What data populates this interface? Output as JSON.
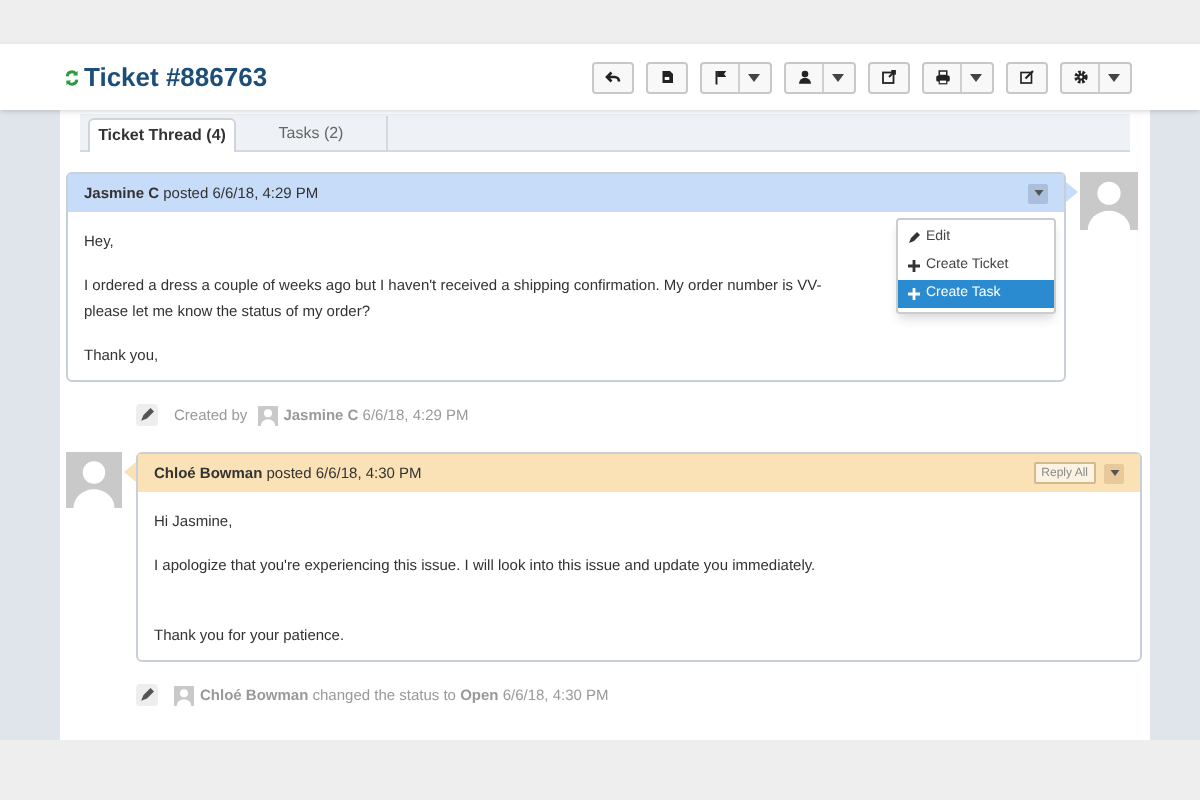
{
  "header": {
    "title": "Ticket #886763"
  },
  "toolbar": [
    {
      "kind": "reply",
      "caret": false
    },
    {
      "kind": "save",
      "caret": false
    },
    {
      "kind": "flag",
      "caret": true
    },
    {
      "kind": "user",
      "caret": true
    },
    {
      "kind": "share",
      "caret": false
    },
    {
      "kind": "print",
      "caret": true
    },
    {
      "kind": "edit",
      "caret": false
    },
    {
      "kind": "gear",
      "caret": true
    }
  ],
  "tabs": [
    {
      "label": "Ticket Thread (4)",
      "selected": true
    },
    {
      "label": "Tasks (2)",
      "selected": false
    }
  ],
  "thread": [
    {
      "kind": "message",
      "color": "#c7dcf8",
      "heading": "**Jasmine C** posted 6/6/18, 4:29 PM",
      "body": [
        "Hey,",
        "I ordered a dress a couple of weeks ago but I haven't received a shipping confirmation. My order number is VV-\nplease let me know the status of my order?",
        "Thank you,"
      ],
      "menu": [
        {
          "kind": "edit",
          "label": "Edit",
          "selected": false
        },
        {
          "kind": "plus",
          "label": "Create Ticket",
          "selected": false
        },
        {
          "kind": "plus",
          "label": "Create Task",
          "selected": true
        }
      ]
    },
    {
      "kind": "event",
      "prefix": "Created by",
      "text": "**Jasmine C** 6/6/18, 4:29 PM"
    },
    {
      "kind": "message",
      "color": "#fbe1b6",
      "heading": "**Chloé Bowman** posted 6/6/18, 4:30 PM",
      "actions": [
        "Reply All"
      ],
      "body": [
        "Hi Jasmine,",
        "I apologize that you're experiencing this issue. I will look into this issue and update you immediately.\n ",
        "Thank you for your patience."
      ]
    },
    {
      "kind": "event",
      "text": "**Chloé Bowman** changed the status to **Open** 6/6/18, 4:30 PM"
    }
  ]
}
